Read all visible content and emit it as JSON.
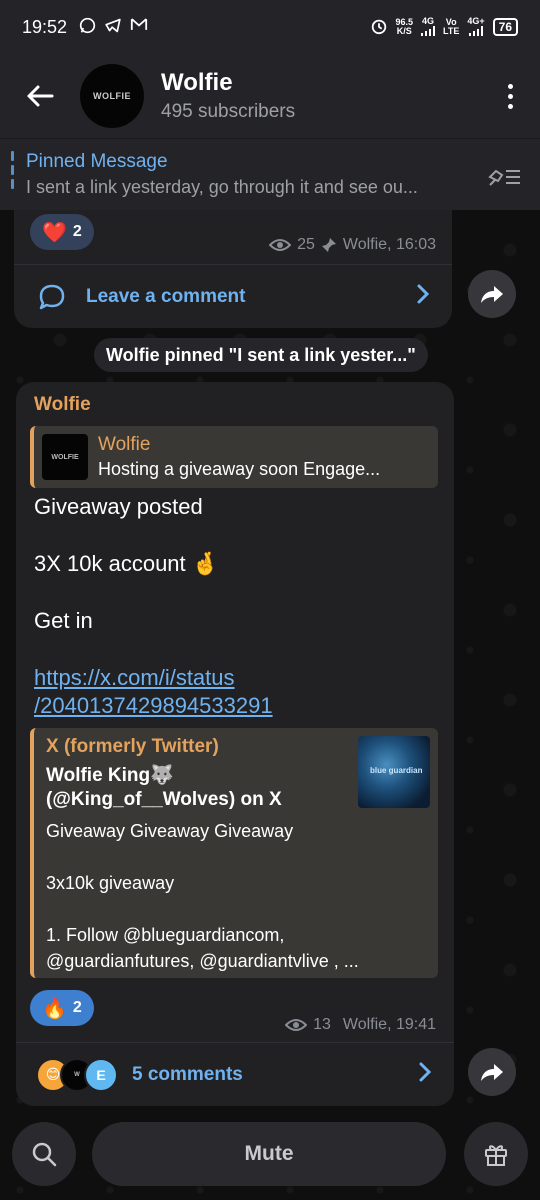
{
  "status_bar": {
    "time": "19:52",
    "left_icons": [
      "whatsapp-icon",
      "telegram-icon",
      "gmail-icon"
    ],
    "speed": "96.5",
    "speed_unit": "K/S",
    "net1": "4G",
    "net2_top": "Vo",
    "net2_bottom": "LTE",
    "net3": "4G+",
    "battery": "76"
  },
  "header": {
    "title": "Wolfie",
    "subtitle": "495 subscribers",
    "avatar_text": "WOLFIE"
  },
  "pinned": {
    "title": "Pinned Message",
    "text": "I sent a link yesterday, go through it and see ou..."
  },
  "message1": {
    "reaction_emoji": "❤️",
    "reaction_count": "2",
    "views": "25",
    "meta": "Wolfie, 16:03",
    "comment_label": "Leave a comment"
  },
  "service": {
    "text": "Wolfie pinned \"I sent a link yester...\""
  },
  "message2": {
    "sender": "Wolfie",
    "reply_name": "Wolfie",
    "reply_text": "Hosting a giveaway soon  Engage...",
    "reply_thumb_text": "WOLFIE",
    "line1": "Giveaway posted",
    "line2": "3X 10k account 🤞",
    "line3": "Get in",
    "link_line1": "https://x.com/i/status",
    "link_line2": "/2040137429894533291",
    "preview": {
      "site": "X (formerly Twitter)",
      "title": "Wolfie King🐺 (@King_of__Wolves) on X",
      "desc": "Giveaway Giveaway Giveaway\n\n 3x10k giveaway\n\n1. Follow @blueguardiancom, @guardianfutures, @guardiantvlive , ...",
      "image_text": "blue guardian"
    },
    "reaction_emoji": "🔥",
    "reaction_count": "2",
    "views": "13",
    "meta": "Wolfie, 19:41",
    "comments_label": "5 comments",
    "avatar_e": "E"
  },
  "bottom": {
    "mute_label": "Mute"
  },
  "colors": {
    "accent_blue": "#6fb2ef",
    "sender_orange": "#e3a35e",
    "bubble": "#212124",
    "reaction_blue": "#3e7fd0"
  }
}
